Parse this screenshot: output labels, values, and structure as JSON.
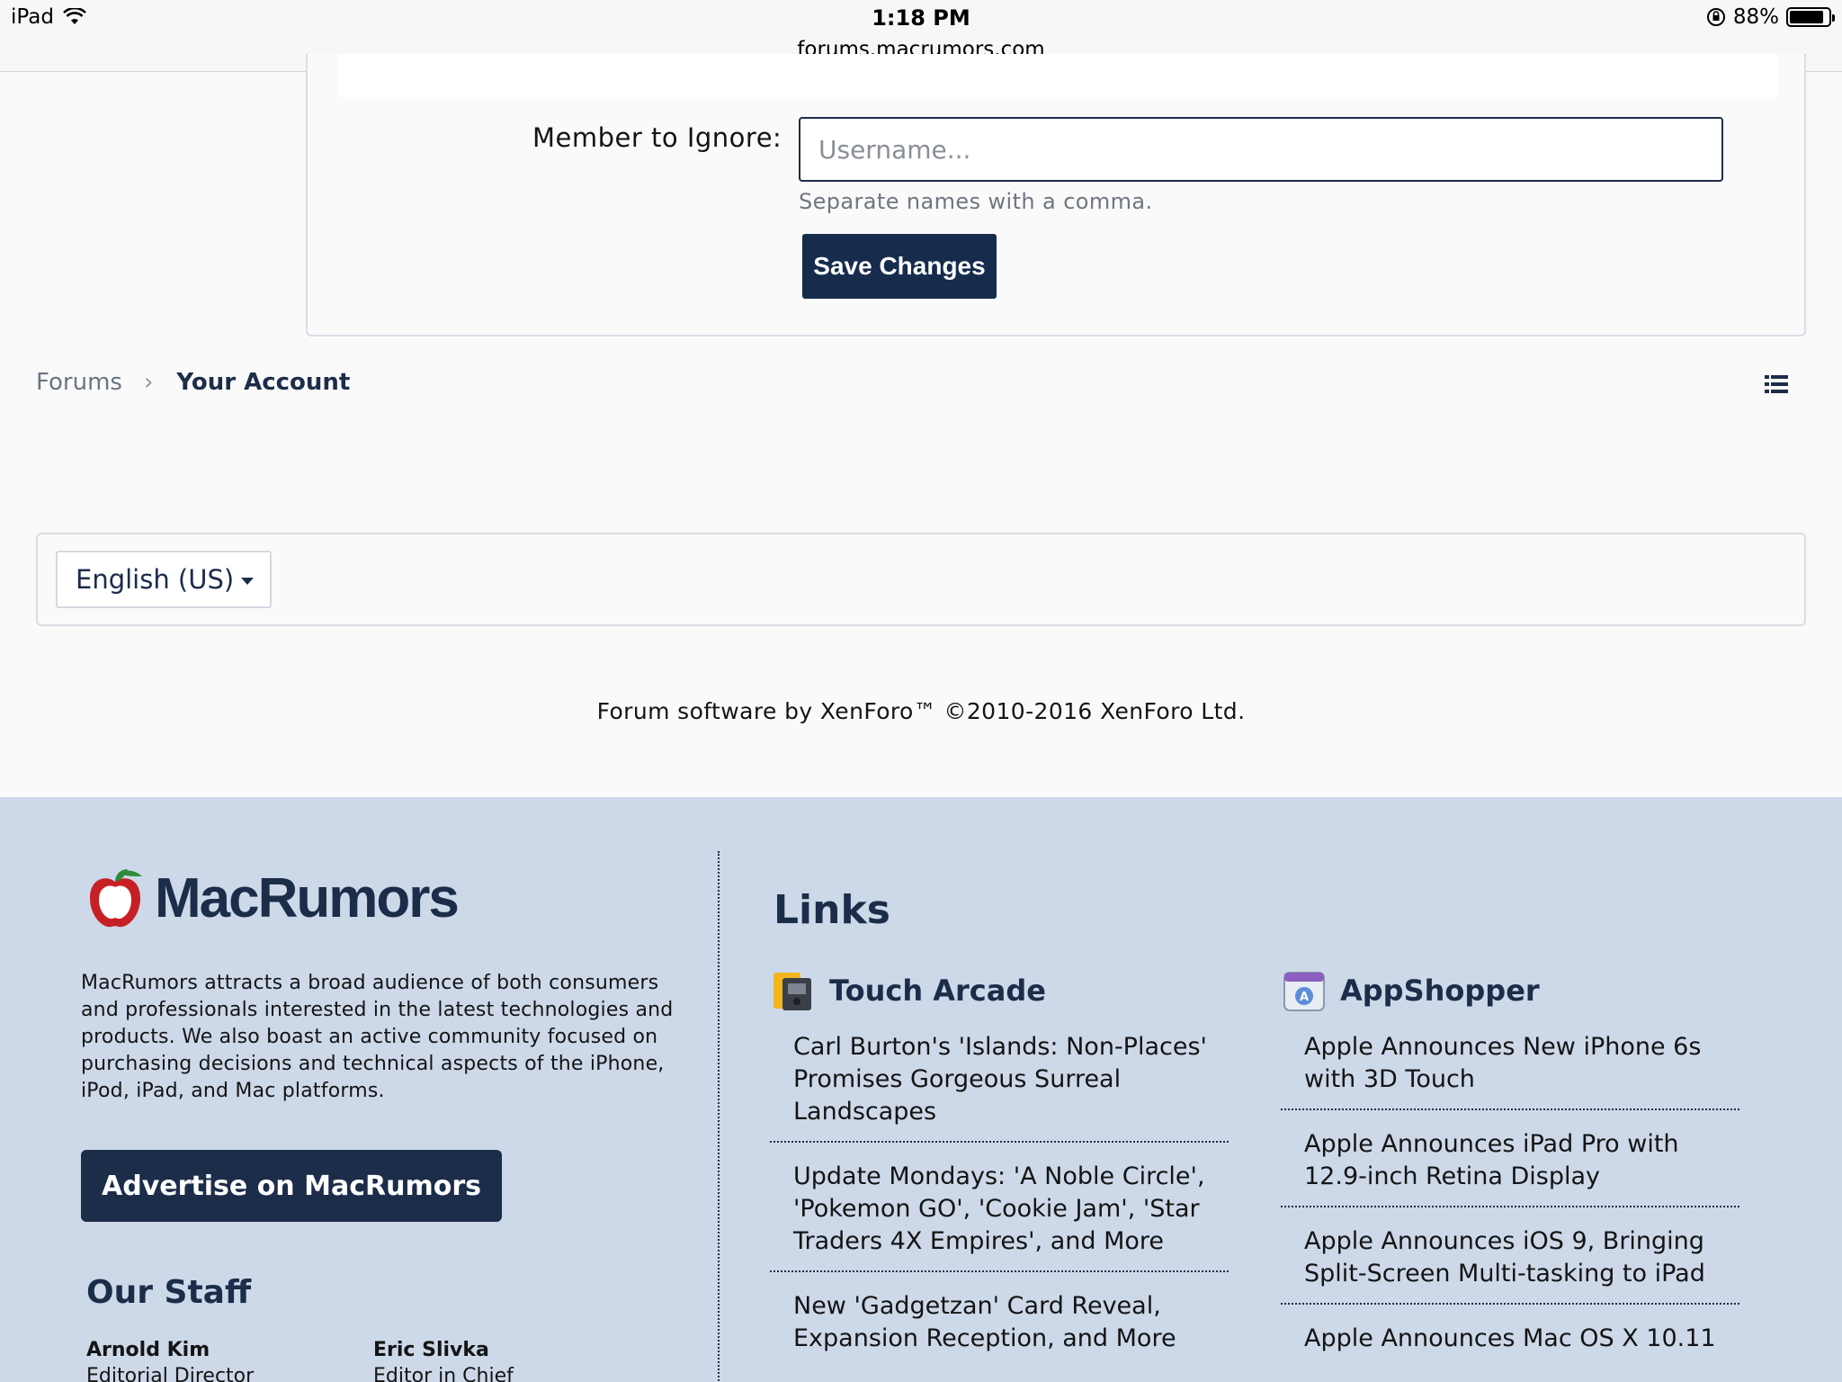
{
  "status_bar": {
    "device": "iPad",
    "time": "1:18 PM",
    "url": "forums.macrumors.com",
    "battery": "88%",
    "battery_level": 0.88
  },
  "ignore_form": {
    "label": "Member to Ignore:",
    "placeholder": "Username...",
    "value": "",
    "hint": "Separate names with a comma.",
    "save_label": "Save Changes"
  },
  "breadcrumb": {
    "items": [
      "Forums",
      "Your Account"
    ]
  },
  "language": {
    "selected": "English (US)"
  },
  "copyright": "Forum software by XenForo™ ©2010-2016 XenForo Ltd.",
  "footer": {
    "logo_text": "MacRumors",
    "about": "MacRumors attracts a broad audience of both consumers and professionals interested in the latest technologies and products. We also boast an active community focused on purchasing decisions and technical aspects of the iPhone, iPod, iPad, and Mac platforms.",
    "advertise_label": "Advertise on MacRumors",
    "staff_title": "Our Staff",
    "staff": [
      {
        "name": "Arnold Kim",
        "role": "Editorial Director"
      },
      {
        "name": "Eric Slivka",
        "role": "Editor in Chief"
      }
    ],
    "links_title": "Links",
    "touch_arcade": {
      "title": "Touch Arcade",
      "items": [
        "Carl Burton's 'Islands: Non-Places' Promises Gorgeous Surreal Landscapes",
        "Update Mondays: 'A Noble Circle', 'Pokemon GO', 'Cookie Jam', 'Star Traders 4X Empires', and More",
        "New 'Gadgetzan' Card Reveal, Expansion Reception, and More"
      ]
    },
    "appshopper": {
      "title": "AppShopper",
      "items": [
        "Apple Announces New iPhone 6s with 3D Touch",
        "Apple Announces iPad Pro with 12.9-inch Retina Display",
        "Apple Announces iOS 9, Bringing Split-Screen Multi-tasking to iPad",
        "Apple Announces Mac OS X 10.11"
      ]
    }
  }
}
